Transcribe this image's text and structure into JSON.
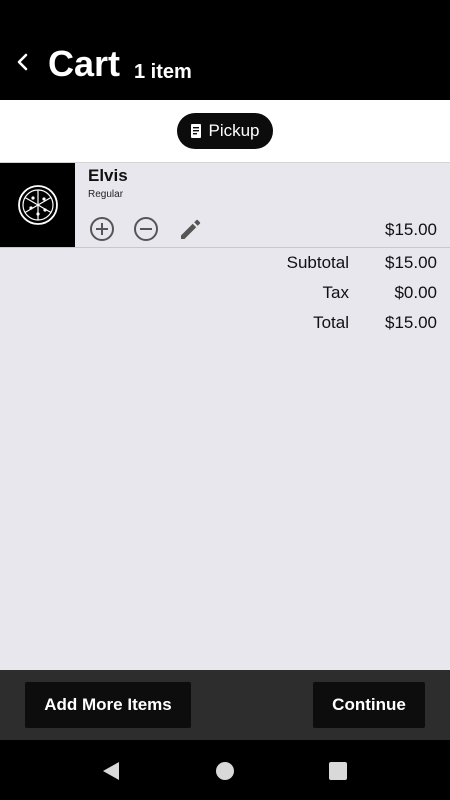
{
  "header": {
    "title": "Cart",
    "item_count": "1 item",
    "back_icon": "chevron-left-icon"
  },
  "mode": {
    "label": "Pickup",
    "icon": "receipt-icon"
  },
  "cart_items": [
    {
      "name": "Elvis",
      "variant": "Regular",
      "price": "$15.00",
      "thumbnail_icon": "pizza-icon"
    }
  ],
  "totals": [
    {
      "label": "Subtotal",
      "value": "$15.00"
    },
    {
      "label": "Tax",
      "value": "$0.00"
    },
    {
      "label": "Total",
      "value": "$15.00"
    }
  ],
  "actions": {
    "add_more_label": "Add More Items",
    "continue_label": "Continue"
  },
  "colors": {
    "header_bg": "#000000",
    "page_bg": "#e8e7ee",
    "action_bar_bg": "#2d2d2d",
    "button_bg": "#0d0d0d"
  }
}
